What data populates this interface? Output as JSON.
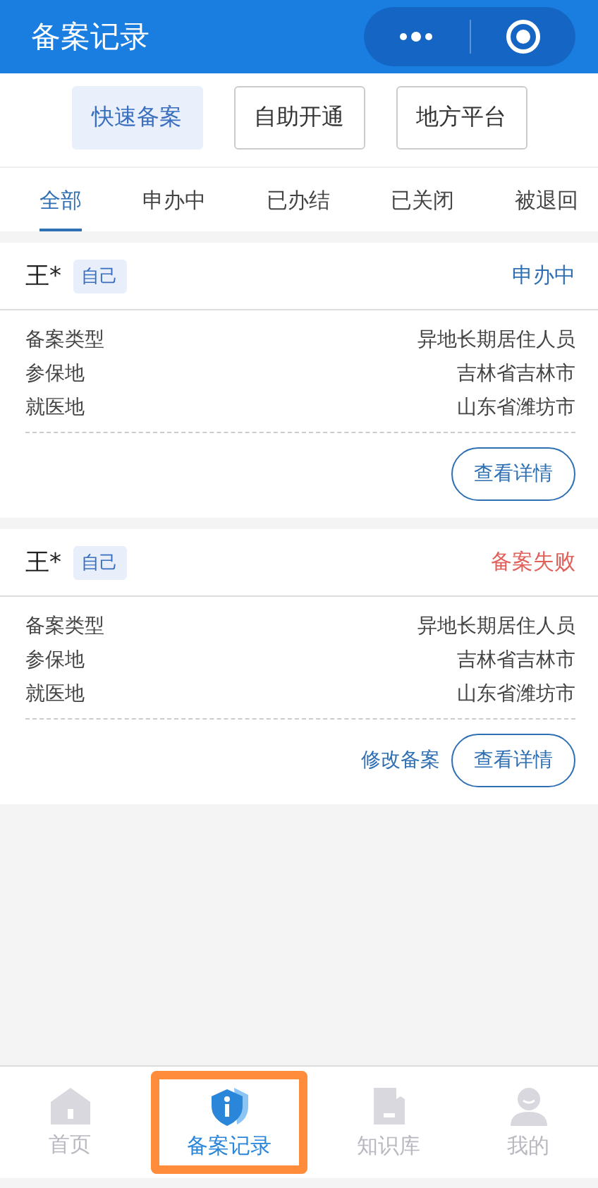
{
  "header": {
    "title": "备案记录"
  },
  "quick_actions": [
    {
      "label": "快速备案",
      "selected": true
    },
    {
      "label": "自助开通",
      "selected": false
    },
    {
      "label": "地方平台",
      "selected": false
    }
  ],
  "tabs": [
    {
      "label": "全部",
      "selected": true
    },
    {
      "label": "申办中",
      "selected": false
    },
    {
      "label": "已办结",
      "selected": false
    },
    {
      "label": "已关闭",
      "selected": false
    },
    {
      "label": "被退回",
      "selected": false
    }
  ],
  "records": [
    {
      "name": "王*",
      "tag": "自己",
      "status": "申办中",
      "color": "#2f6fb3",
      "fields": [
        {
          "label": "备案类型",
          "value": "异地长期居住人员"
        },
        {
          "label": "参保地",
          "value": "吉林省吉林市"
        },
        {
          "label": "就医地",
          "value": "山东省潍坊市"
        }
      ],
      "actions": [
        {
          "kind": "outline",
          "label": "查看详情"
        }
      ]
    },
    {
      "name": "王*",
      "tag": "自己",
      "status": "备案失败",
      "color": "#e0605a",
      "fields": [
        {
          "label": "备案类型",
          "value": "异地长期居住人员"
        },
        {
          "label": "参保地",
          "value": "吉林省吉林市"
        },
        {
          "label": "就医地",
          "value": "山东省潍坊市"
        }
      ],
      "actions": [
        {
          "kind": "link",
          "label": "修改备案"
        },
        {
          "kind": "outline",
          "label": "查看详情"
        }
      ]
    }
  ],
  "bottom_nav": [
    {
      "label": "首页",
      "selected": false
    },
    {
      "label": "备案记录",
      "selected": true
    },
    {
      "label": "知识库",
      "selected": false
    },
    {
      "label": "我的",
      "selected": false
    }
  ]
}
